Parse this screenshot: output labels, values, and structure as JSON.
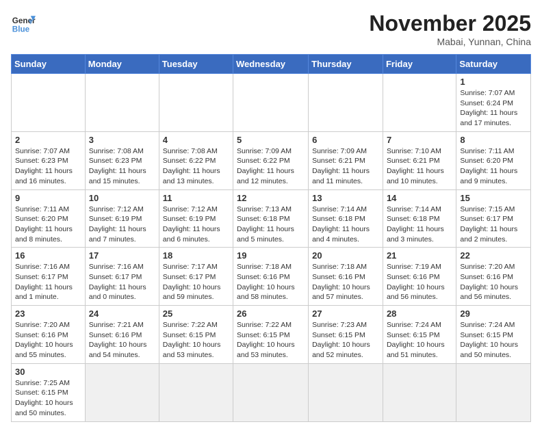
{
  "header": {
    "logo_general": "General",
    "logo_blue": "Blue",
    "month_title": "November 2025",
    "location": "Mabai, Yunnan, China"
  },
  "days_of_week": [
    "Sunday",
    "Monday",
    "Tuesday",
    "Wednesday",
    "Thursday",
    "Friday",
    "Saturday"
  ],
  "weeks": [
    [
      {
        "day": "",
        "info": ""
      },
      {
        "day": "",
        "info": ""
      },
      {
        "day": "",
        "info": ""
      },
      {
        "day": "",
        "info": ""
      },
      {
        "day": "",
        "info": ""
      },
      {
        "day": "",
        "info": ""
      },
      {
        "day": "1",
        "info": "Sunrise: 7:07 AM\nSunset: 6:24 PM\nDaylight: 11 hours and 17 minutes."
      }
    ],
    [
      {
        "day": "2",
        "info": "Sunrise: 7:07 AM\nSunset: 6:23 PM\nDaylight: 11 hours and 16 minutes."
      },
      {
        "day": "3",
        "info": "Sunrise: 7:08 AM\nSunset: 6:23 PM\nDaylight: 11 hours and 15 minutes."
      },
      {
        "day": "4",
        "info": "Sunrise: 7:08 AM\nSunset: 6:22 PM\nDaylight: 11 hours and 13 minutes."
      },
      {
        "day": "5",
        "info": "Sunrise: 7:09 AM\nSunset: 6:22 PM\nDaylight: 11 hours and 12 minutes."
      },
      {
        "day": "6",
        "info": "Sunrise: 7:09 AM\nSunset: 6:21 PM\nDaylight: 11 hours and 11 minutes."
      },
      {
        "day": "7",
        "info": "Sunrise: 7:10 AM\nSunset: 6:21 PM\nDaylight: 11 hours and 10 minutes."
      },
      {
        "day": "8",
        "info": "Sunrise: 7:11 AM\nSunset: 6:20 PM\nDaylight: 11 hours and 9 minutes."
      }
    ],
    [
      {
        "day": "9",
        "info": "Sunrise: 7:11 AM\nSunset: 6:20 PM\nDaylight: 11 hours and 8 minutes."
      },
      {
        "day": "10",
        "info": "Sunrise: 7:12 AM\nSunset: 6:19 PM\nDaylight: 11 hours and 7 minutes."
      },
      {
        "day": "11",
        "info": "Sunrise: 7:12 AM\nSunset: 6:19 PM\nDaylight: 11 hours and 6 minutes."
      },
      {
        "day": "12",
        "info": "Sunrise: 7:13 AM\nSunset: 6:18 PM\nDaylight: 11 hours and 5 minutes."
      },
      {
        "day": "13",
        "info": "Sunrise: 7:14 AM\nSunset: 6:18 PM\nDaylight: 11 hours and 4 minutes."
      },
      {
        "day": "14",
        "info": "Sunrise: 7:14 AM\nSunset: 6:18 PM\nDaylight: 11 hours and 3 minutes."
      },
      {
        "day": "15",
        "info": "Sunrise: 7:15 AM\nSunset: 6:17 PM\nDaylight: 11 hours and 2 minutes."
      }
    ],
    [
      {
        "day": "16",
        "info": "Sunrise: 7:16 AM\nSunset: 6:17 PM\nDaylight: 11 hours and 1 minute."
      },
      {
        "day": "17",
        "info": "Sunrise: 7:16 AM\nSunset: 6:17 PM\nDaylight: 11 hours and 0 minutes."
      },
      {
        "day": "18",
        "info": "Sunrise: 7:17 AM\nSunset: 6:17 PM\nDaylight: 10 hours and 59 minutes."
      },
      {
        "day": "19",
        "info": "Sunrise: 7:18 AM\nSunset: 6:16 PM\nDaylight: 10 hours and 58 minutes."
      },
      {
        "day": "20",
        "info": "Sunrise: 7:18 AM\nSunset: 6:16 PM\nDaylight: 10 hours and 57 minutes."
      },
      {
        "day": "21",
        "info": "Sunrise: 7:19 AM\nSunset: 6:16 PM\nDaylight: 10 hours and 56 minutes."
      },
      {
        "day": "22",
        "info": "Sunrise: 7:20 AM\nSunset: 6:16 PM\nDaylight: 10 hours and 56 minutes."
      }
    ],
    [
      {
        "day": "23",
        "info": "Sunrise: 7:20 AM\nSunset: 6:16 PM\nDaylight: 10 hours and 55 minutes."
      },
      {
        "day": "24",
        "info": "Sunrise: 7:21 AM\nSunset: 6:16 PM\nDaylight: 10 hours and 54 minutes."
      },
      {
        "day": "25",
        "info": "Sunrise: 7:22 AM\nSunset: 6:15 PM\nDaylight: 10 hours and 53 minutes."
      },
      {
        "day": "26",
        "info": "Sunrise: 7:22 AM\nSunset: 6:15 PM\nDaylight: 10 hours and 53 minutes."
      },
      {
        "day": "27",
        "info": "Sunrise: 7:23 AM\nSunset: 6:15 PM\nDaylight: 10 hours and 52 minutes."
      },
      {
        "day": "28",
        "info": "Sunrise: 7:24 AM\nSunset: 6:15 PM\nDaylight: 10 hours and 51 minutes."
      },
      {
        "day": "29",
        "info": "Sunrise: 7:24 AM\nSunset: 6:15 PM\nDaylight: 10 hours and 50 minutes."
      }
    ],
    [
      {
        "day": "30",
        "info": "Sunrise: 7:25 AM\nSunset: 6:15 PM\nDaylight: 10 hours and 50 minutes."
      },
      {
        "day": "",
        "info": ""
      },
      {
        "day": "",
        "info": ""
      },
      {
        "day": "",
        "info": ""
      },
      {
        "day": "",
        "info": ""
      },
      {
        "day": "",
        "info": ""
      },
      {
        "day": "",
        "info": ""
      }
    ]
  ]
}
